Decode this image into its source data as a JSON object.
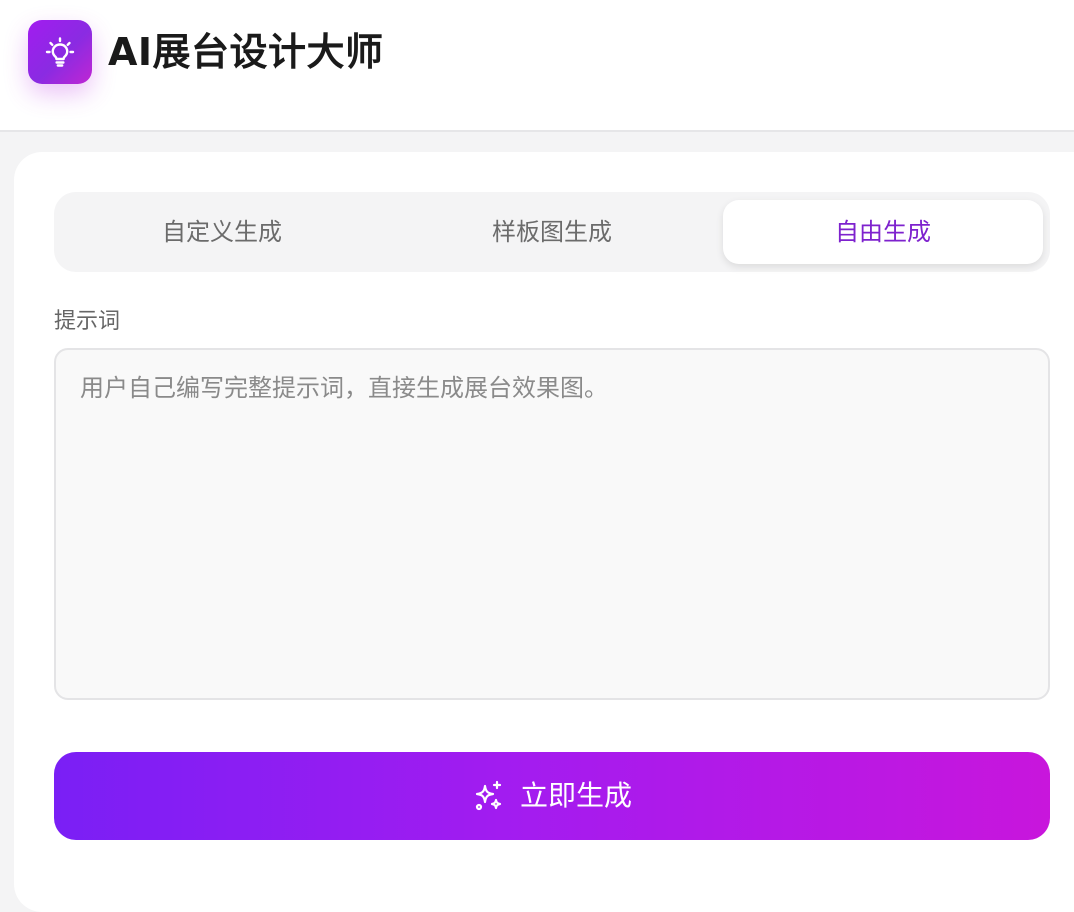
{
  "header": {
    "title": "AI展台设计大师",
    "logo_icon": "lightbulb-icon",
    "accent_color": "#a21cf0"
  },
  "tabs": [
    {
      "label": "自定义生成",
      "active": false
    },
    {
      "label": "样板图生成",
      "active": false
    },
    {
      "label": "自由生成",
      "active": true
    }
  ],
  "prompt": {
    "label": "提示词",
    "value": "",
    "placeholder": "用户自己编写完整提示词，直接生成展台效果图。"
  },
  "generate_button": {
    "label": "立即生成",
    "icon": "sparkles-icon",
    "gradient": [
      "#7a1ff5",
      "#c816dc"
    ]
  }
}
